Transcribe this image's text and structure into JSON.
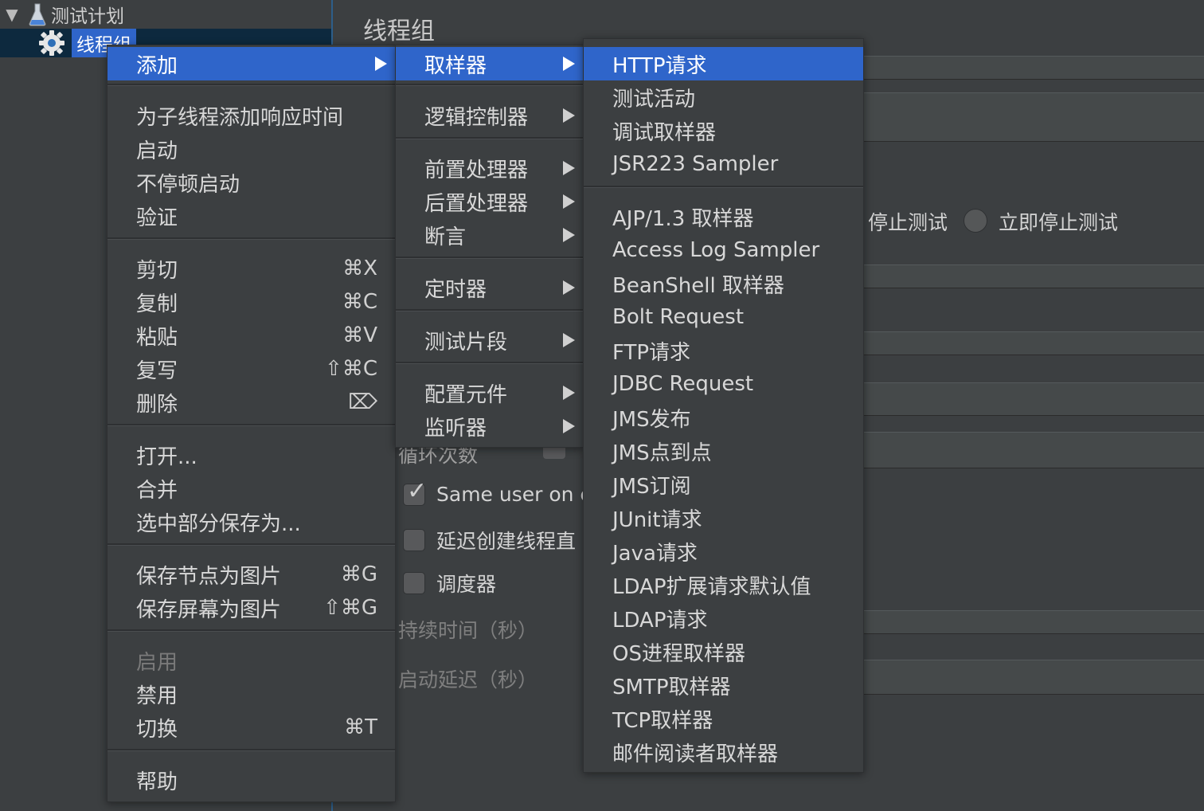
{
  "tree": {
    "toggle": "▼",
    "test_plan_label": "测试计划",
    "thread_group_label": "线程组"
  },
  "form": {
    "title": "线程组",
    "stop_test": "停止测试",
    "stop_now": "立即停止测试",
    "loop_count": "循环次数",
    "same_user": "Same user on e",
    "delay_create": "延迟创建线程直",
    "scheduler": "调度器",
    "duration": "持续时间（秒）",
    "startup_delay": "启动延迟（秒）"
  },
  "menu_main": {
    "add": "添加",
    "add_resp_time": "为子线程添加响应时间",
    "start": "启动",
    "start_no_pause": "不停顿启动",
    "validate": "验证",
    "cut": "剪切",
    "cut_sc": "⌘X",
    "copy": "复制",
    "copy_sc": "⌘C",
    "paste": "粘贴",
    "paste_sc": "⌘V",
    "duplicate": "复写",
    "duplicate_sc": "⇧⌘C",
    "delete": "删除",
    "delete_sc": "⌦",
    "open": "打开...",
    "merge": "合并",
    "save_selection": "选中部分保存为...",
    "save_node_img": "保存节点为图片",
    "save_node_img_sc": "⌘G",
    "save_screen_img": "保存屏幕为图片",
    "save_screen_img_sc": "⇧⌘G",
    "enable": "启用",
    "disable": "禁用",
    "toggle": "切换",
    "toggle_sc": "⌘T",
    "help": "帮助"
  },
  "menu_add": {
    "sampler": "取样器",
    "logic_controller": "逻辑控制器",
    "pre_processor": "前置处理器",
    "post_processor": "后置处理器",
    "assertion": "断言",
    "timer": "定时器",
    "test_fragment": "测试片段",
    "config_element": "配置元件",
    "listener": "监听器"
  },
  "menu_sampler": {
    "items": [
      "HTTP请求",
      "测试活动",
      "调试取样器",
      "JSR223 Sampler",
      "AJP/1.3 取样器",
      "Access Log Sampler",
      "BeanShell 取样器",
      "Bolt Request",
      "FTP请求",
      "JDBC Request",
      "JMS发布",
      "JMS点到点",
      "JMS订阅",
      "JUnit请求",
      "Java请求",
      "LDAP扩展请求默认值",
      "LDAP请求",
      "OS进程取样器",
      "SMTP取样器",
      "TCP取样器",
      "邮件阅读者取样器"
    ]
  },
  "colors": {
    "highlight": "#2f65ca",
    "menu_bg": "#3c3f41",
    "text": "#d8d8d8"
  }
}
